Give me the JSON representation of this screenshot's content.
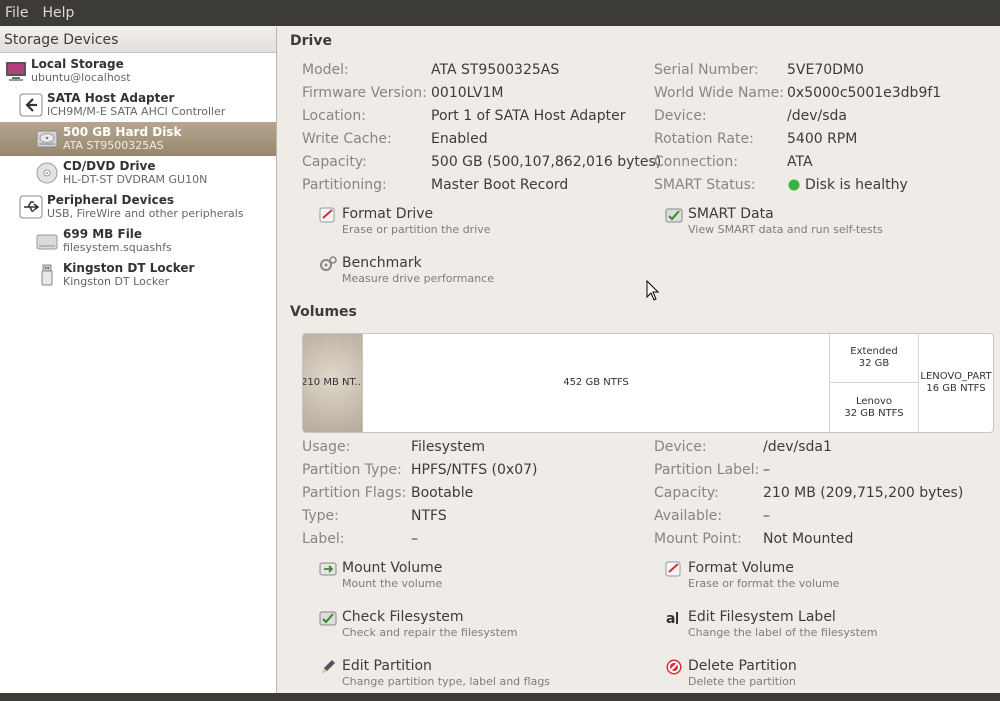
{
  "menu": {
    "file": "File",
    "help": "Help"
  },
  "sidebar": {
    "header": "Storage Devices",
    "items": [
      {
        "title": "Local Storage",
        "subtitle": "ubuntu@localhost",
        "icon": "computer-icon"
      },
      {
        "title": "SATA Host Adapter",
        "subtitle": "ICH9M/M-E SATA AHCI Controller",
        "icon": "adapter-icon"
      },
      {
        "title": "500 GB Hard Disk",
        "subtitle": "ATA ST9500325AS",
        "icon": "harddisk-icon",
        "selected": true
      },
      {
        "title": "CD/DVD Drive",
        "subtitle": "HL-DT-ST DVDRAM GU10N",
        "icon": "optical-disc-icon"
      },
      {
        "title": "Peripheral Devices",
        "subtitle": "USB, FireWire and other peripherals",
        "icon": "usb-icon"
      },
      {
        "title": "699 MB File",
        "subtitle": "filesystem.squashfs",
        "icon": "file-drive-icon"
      },
      {
        "title": "Kingston DT Locker",
        "subtitle": "Kingston DT Locker",
        "icon": "usb-stick-icon"
      }
    ]
  },
  "drive": {
    "title": "Drive",
    "left": [
      {
        "label": "Model:",
        "value": "ATA ST9500325AS"
      },
      {
        "label": "Firmware Version:",
        "value": "0010LV1M"
      },
      {
        "label": "Location:",
        "value": "Port 1 of SATA Host Adapter"
      },
      {
        "label": "Write Cache:",
        "value": "Enabled"
      },
      {
        "label": "Capacity:",
        "value": "500 GB (500,107,862,016 bytes)"
      },
      {
        "label": "Partitioning:",
        "value": "Master Boot Record"
      }
    ],
    "right": [
      {
        "label": "Serial Number:",
        "value": "5VE70DM0"
      },
      {
        "label": "World Wide Name:",
        "value": "0x5000c5001e3db9f1"
      },
      {
        "label": "Device:",
        "value": "/dev/sda"
      },
      {
        "label": "Rotation Rate:",
        "value": "5400 RPM"
      },
      {
        "label": "Connection:",
        "value": "ATA"
      },
      {
        "label": "SMART Status:",
        "value": "Disk is healthy",
        "status_color": "#3cb043"
      }
    ],
    "actions": [
      {
        "title": "Format Drive",
        "subtitle": "Erase or partition the drive"
      },
      {
        "title": "SMART Data",
        "subtitle": "View SMART data and run self-tests"
      },
      {
        "title": "Benchmark",
        "subtitle": "Measure drive performance"
      }
    ]
  },
  "volumes": {
    "title": "Volumes",
    "segments": [
      {
        "line1": "210 MB NT...",
        "line2": ""
      },
      {
        "line1": "452 GB NTFS",
        "line2": ""
      },
      {
        "line1": "Extended",
        "line2": "32 GB"
      },
      {
        "line1": "Lenovo",
        "line2": "32 GB NTFS"
      },
      {
        "line1": "LENOVO_PART",
        "line2": "16 GB NTFS"
      }
    ],
    "left": [
      {
        "label": "Usage:",
        "value": "Filesystem"
      },
      {
        "label": "Partition Type:",
        "value": "HPFS/NTFS (0x07)"
      },
      {
        "label": "Partition Flags:",
        "value": "Bootable"
      },
      {
        "label": "Type:",
        "value": "NTFS"
      },
      {
        "label": "Label:",
        "value": "–"
      }
    ],
    "right": [
      {
        "label": "Device:",
        "value": "/dev/sda1"
      },
      {
        "label": "Partition Label:",
        "value": "–"
      },
      {
        "label": "Capacity:",
        "value": "210 MB (209,715,200 bytes)"
      },
      {
        "label": "Available:",
        "value": "–"
      },
      {
        "label": "Mount Point:",
        "value": "Not Mounted"
      }
    ],
    "actions": [
      {
        "title": "Mount Volume",
        "subtitle": "Mount the volume"
      },
      {
        "title": "Format Volume",
        "subtitle": "Erase or format the volume"
      },
      {
        "title": "Check Filesystem",
        "subtitle": "Check and repair the filesystem"
      },
      {
        "title": "Edit Filesystem Label",
        "subtitle": "Change the label of the filesystem"
      },
      {
        "title": "Edit Partition",
        "subtitle": "Change partition type, label and flags"
      },
      {
        "title": "Delete Partition",
        "subtitle": "Delete the partition"
      }
    ]
  }
}
